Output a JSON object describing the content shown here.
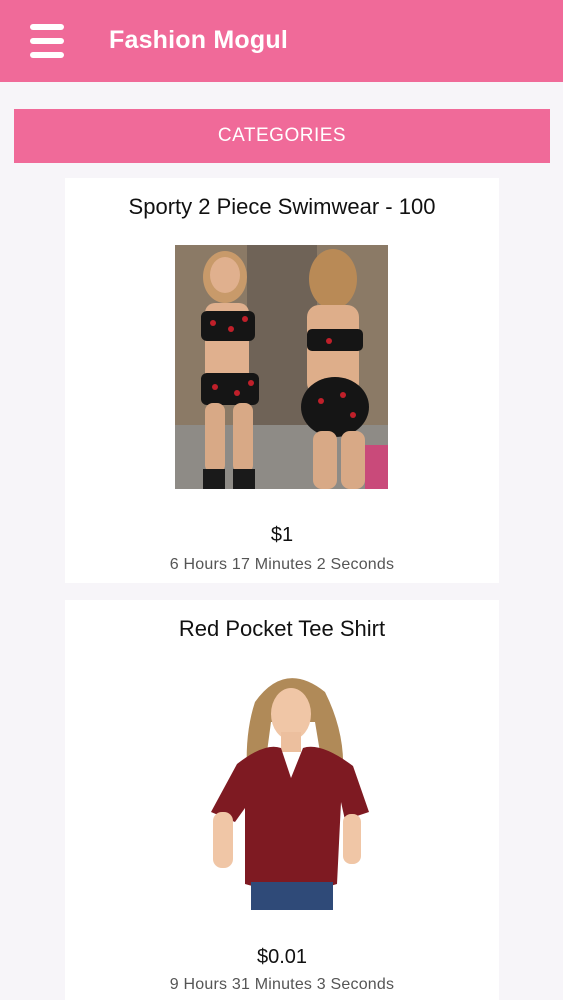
{
  "header": {
    "title": "Fashion Mogul",
    "menu_icon": "hamburger-menu-icon",
    "background_color": "#f06a99"
  },
  "categories_label": "CATEGORIES",
  "products": [
    {
      "title": "Sporty 2 Piece Swimwear - 100",
      "price": "$1",
      "time_left": "6 Hours 17 Minutes 2 Seconds"
    },
    {
      "title": "Red Pocket Tee Shirt",
      "price": "$0.01",
      "time_left": "9 Hours 31 Minutes 3 Seconds"
    }
  ],
  "colors": {
    "accent": "#f06a99",
    "page_background": "#f7f5f9",
    "card_background": "#ffffff"
  }
}
